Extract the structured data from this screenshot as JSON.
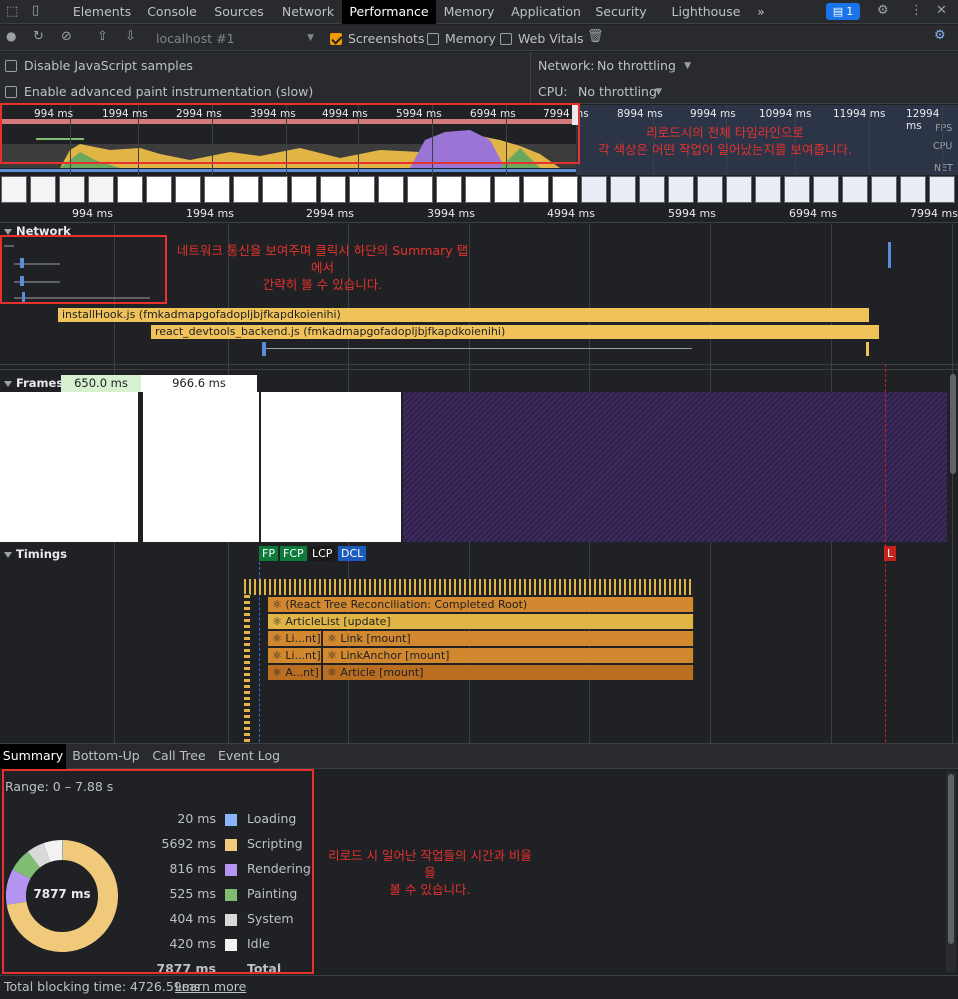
{
  "topbar": {
    "tabs": [
      "Elements",
      "Console",
      "Sources",
      "Network",
      "Performance",
      "Memory",
      "Application",
      "Security",
      "Lighthouse"
    ],
    "active_tab": "Performance",
    "more": "»",
    "issues_count": "1"
  },
  "toolbar": {
    "target": "localhost #1",
    "screenshots_label": "Screenshots",
    "memory_label": "Memory",
    "webvitals_label": "Web Vitals"
  },
  "settings": {
    "disable_js_samples": "Disable JavaScript samples",
    "adv_paint": "Enable advanced paint instrumentation (slow)",
    "network_label": "Network:",
    "network_value": "No throttling",
    "cpu_label": "CPU:",
    "cpu_value": "No throttling"
  },
  "overview": {
    "ticks": [
      "994 ms",
      "1994 ms",
      "2994 ms",
      "3994 ms",
      "4994 ms",
      "5994 ms",
      "6994 ms",
      "7994 ms",
      "8994 ms",
      "9994 ms",
      "10994 ms",
      "11994 ms",
      "12994 ms"
    ],
    "labels": {
      "fps": "FPS",
      "cpu": "CPU",
      "net": "NET"
    }
  },
  "main_ticks": [
    "994 ms",
    "1994 ms",
    "2994 ms",
    "3994 ms",
    "4994 ms",
    "5994 ms",
    "6994 ms",
    "7994 ms"
  ],
  "network": {
    "title": "Network",
    "bars": [
      {
        "label": "installHook.js (fmkadmapgofadopljbjfkapdkoienihi)"
      },
      {
        "label": "react_devtools_backend.js (fmkadmapgofadopljbjfkapdkoienihi)"
      }
    ]
  },
  "frames": {
    "title": "Frames",
    "frame1": "650.0 ms",
    "frame2": "966.6 ms"
  },
  "timings": {
    "title": "Timings",
    "fp": "FP",
    "fcp": "FCP",
    "lcp": "LCP",
    "dcl": "DCL",
    "l": "L",
    "flames": {
      "row1": "⚛ (React Tree Reconciliation: Completed Root)",
      "row2": "⚛ ArticleList [update]",
      "row3a": "⚛ Li...nt]",
      "row3b": "⚛ Link [mount]",
      "row4a": "⚛ Li...nt]",
      "row4b": "⚛ LinkAnchor [mount]",
      "row5a": "⚛ A...nt]",
      "row5b": "⚛ Article [mount]"
    }
  },
  "bottom_tabs": [
    "Summary",
    "Bottom-Up",
    "Call Tree",
    "Event Log"
  ],
  "summary": {
    "range": "Range: 0 – 7.88 s",
    "total_center": "7877 ms",
    "items": [
      {
        "value": "20 ms",
        "name": "Loading",
        "color": "#8ab4f8",
        "ms": 20
      },
      {
        "value": "5692 ms",
        "name": "Scripting",
        "color": "#f0c97a",
        "ms": 5692
      },
      {
        "value": "816 ms",
        "name": "Rendering",
        "color": "#b694f2",
        "ms": 816
      },
      {
        "value": "525 ms",
        "name": "Painting",
        "color": "#7fbe72",
        "ms": 525
      },
      {
        "value": "404 ms",
        "name": "System",
        "color": "#d9d9d9",
        "ms": 404
      },
      {
        "value": "420 ms",
        "name": "Idle",
        "color": "#f3f3f3",
        "ms": 420
      }
    ],
    "total_value": "7877 ms",
    "total_label": "Total"
  },
  "footer": {
    "tbt": "Total blocking time: 4726.59ms",
    "learn_more": "Learn more"
  },
  "annotations": {
    "overview": "리로드시의 전체 타임라인으로\n각 색상은 어떤 작업이 일어났는지를 보여줍니다.",
    "network": "네트워크 통신을 보여주며 클릭시 하단의 Summary 탭에서\n간략히 볼 수 있습니다.",
    "summary": "리로드 시 일어난 작업들의 시간과 비율을\n볼 수 있습니다."
  },
  "colors": {
    "accent": "#f29900",
    "annotation": "#e5322d",
    "scripting": "#f0c35a"
  }
}
